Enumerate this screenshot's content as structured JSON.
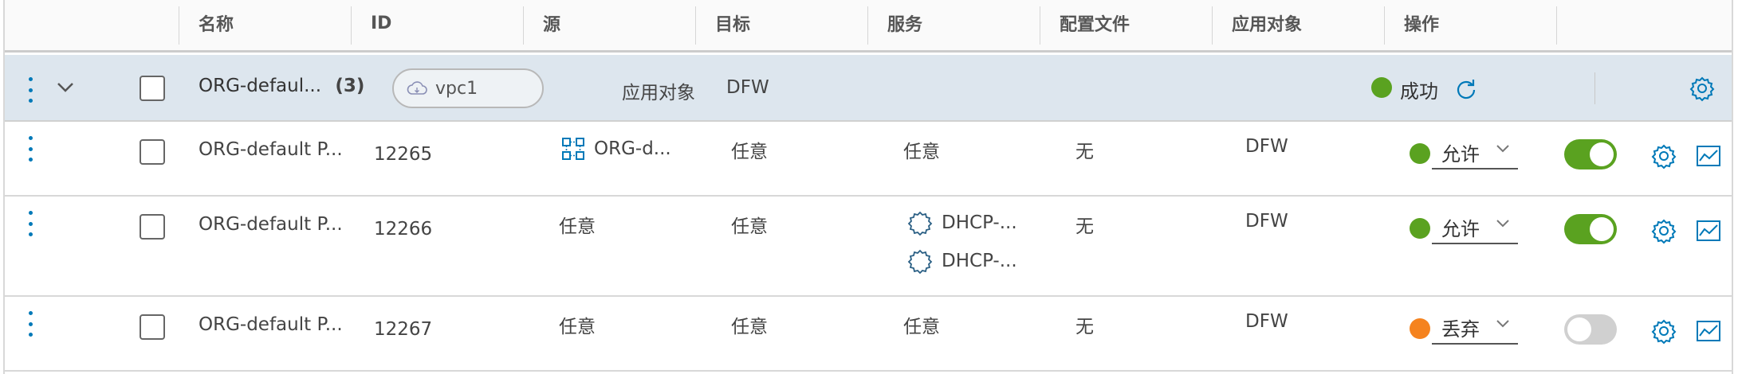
{
  "header": {
    "columns": [
      "名称",
      "ID",
      "源",
      "目标",
      "服务",
      "配置文件",
      "应用对象",
      "操作"
    ]
  },
  "group": {
    "name": "ORG-defaul...",
    "count": "(3)",
    "vpc_tag": "vpc1",
    "applied_to_label": "应用对象",
    "applied_to_value": "DFW",
    "status_text": "成功",
    "status_color": "#5aa220"
  },
  "rules": [
    {
      "name": "ORG-default P...",
      "id": "12265",
      "source": "ORG-d...",
      "destination": "任意",
      "services": [
        "任意"
      ],
      "profile": "无",
      "applied_to": "DFW",
      "action": "允许",
      "action_color": "#5aa220",
      "enabled": true
    },
    {
      "name": "ORG-default P...",
      "id": "12266",
      "source": "任意",
      "destination": "任意",
      "services": [
        "DHCP-...",
        "DHCP-..."
      ],
      "profile": "无",
      "applied_to": "DFW",
      "action": "允许",
      "action_color": "#5aa220",
      "enabled": true
    },
    {
      "name": "ORG-default P...",
      "id": "12267",
      "source": "任意",
      "destination": "任意",
      "services": [
        "任意"
      ],
      "profile": "无",
      "applied_to": "DFW",
      "action": "丢弃",
      "action_color": "#f5831f",
      "enabled": false
    }
  ],
  "colors": {
    "accent": "#0079b8",
    "header_bg": "#fafafa",
    "group_bg": "#dde6ee"
  }
}
